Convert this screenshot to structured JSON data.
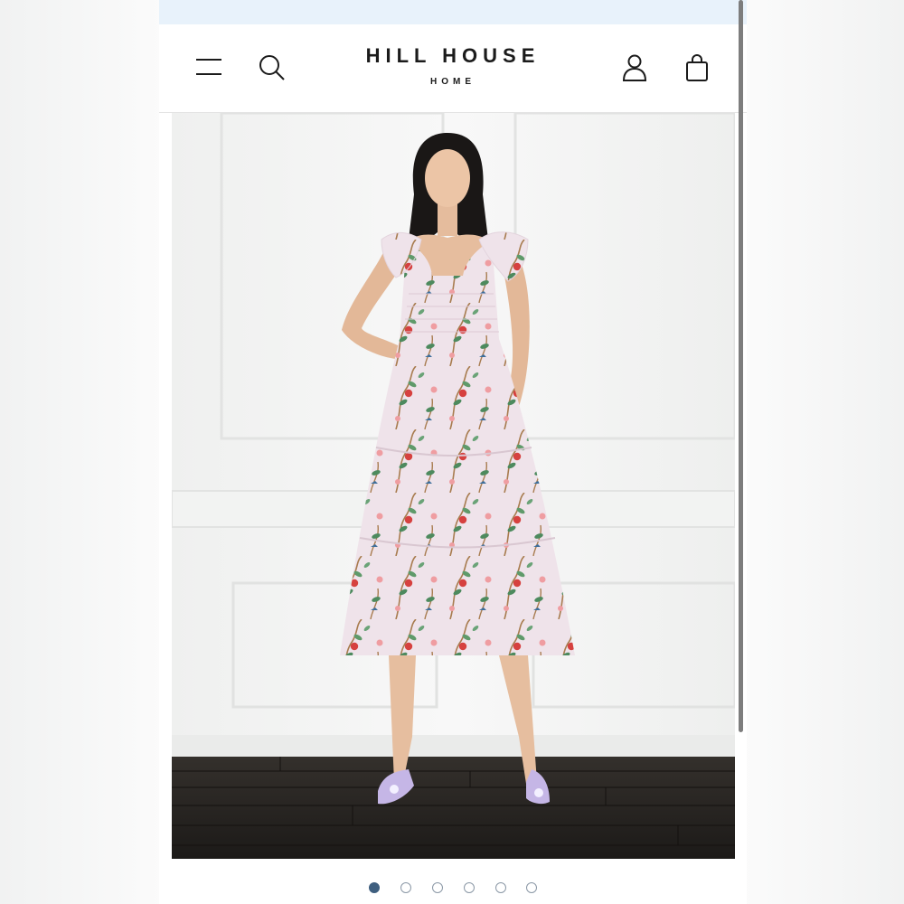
{
  "brand": {
    "title": "HILL HOUSE",
    "subtitle": "HOME"
  },
  "header": {
    "icons": [
      "menu-icon",
      "search-icon",
      "account-icon",
      "bag-icon"
    ]
  },
  "colors": {
    "promo_bar": "#e8f2fb",
    "text": "#1b1b1b",
    "dot_active": "#3f5f7f",
    "dot_outline": "#8b98a6"
  },
  "carousel": {
    "total_slides": 6,
    "active_slide": 1
  }
}
